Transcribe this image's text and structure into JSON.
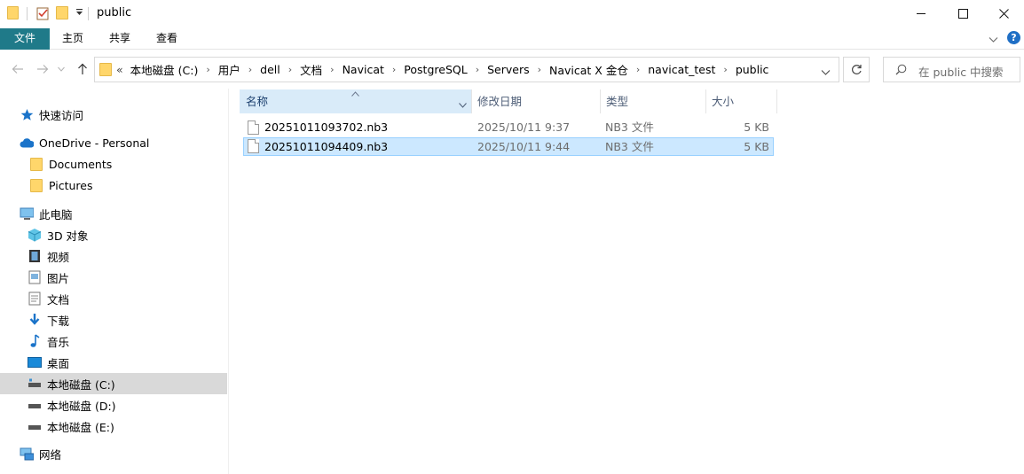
{
  "window": {
    "title": "public",
    "controls": {
      "minimize_icon": "minimize-icon",
      "maximize_icon": "maximize-icon",
      "close_icon": "close-icon"
    }
  },
  "ribbon": {
    "tabs": [
      {
        "label": "文件",
        "active": true
      },
      {
        "label": "主页"
      },
      {
        "label": "共享"
      },
      {
        "label": "查看"
      }
    ]
  },
  "address": {
    "overflow": "«",
    "crumbs": [
      "本地磁盘 (C:)",
      "用户",
      "dell",
      "文档",
      "Navicat",
      "PostgreSQL",
      "Servers",
      "Navicat X 金仓",
      "navicat_test",
      "public"
    ]
  },
  "search": {
    "placeholder": "在 public 中搜索"
  },
  "nav": {
    "items": [
      {
        "label": "快速访问",
        "icon": "star-icon"
      },
      {
        "label": "OneDrive - Personal",
        "icon": "cloud-icon"
      },
      {
        "label": "Documents",
        "icon": "folder-icon"
      },
      {
        "label": "Pictures",
        "icon": "folder-icon"
      },
      {
        "label": "此电脑",
        "icon": "pc-icon"
      },
      {
        "label": "3D 对象",
        "icon": "cube-icon"
      },
      {
        "label": "视频",
        "icon": "video-icon"
      },
      {
        "label": "图片",
        "icon": "pictures-icon"
      },
      {
        "label": "文档",
        "icon": "documents-icon"
      },
      {
        "label": "下载",
        "icon": "download-icon"
      },
      {
        "label": "音乐",
        "icon": "music-icon"
      },
      {
        "label": "桌面",
        "icon": "desktop-icon"
      },
      {
        "label": "本地磁盘 (C:)",
        "icon": "drive-icon",
        "selected": true
      },
      {
        "label": "本地磁盘 (D:)",
        "icon": "drive-icon"
      },
      {
        "label": "本地磁盘 (E:)",
        "icon": "drive-icon"
      },
      {
        "label": "网络",
        "icon": "network-icon"
      }
    ]
  },
  "list": {
    "columns": [
      "名称",
      "修改日期",
      "类型",
      "大小"
    ],
    "sorted_column": "名称",
    "files": [
      {
        "name": "20251011093702.nb3",
        "modified": "2025/10/11 9:37",
        "type": "NB3 文件",
        "size": "5 KB",
        "selected": false
      },
      {
        "name": "20251011094409.nb3",
        "modified": "2025/10/11 9:44",
        "type": "NB3 文件",
        "size": "5 KB",
        "selected": true
      }
    ]
  },
  "colors": {
    "file_tab": "#1f7a89",
    "selection": "#cce8ff",
    "nav_selected": "#d9d9d9",
    "folder": "#ffd66b"
  }
}
